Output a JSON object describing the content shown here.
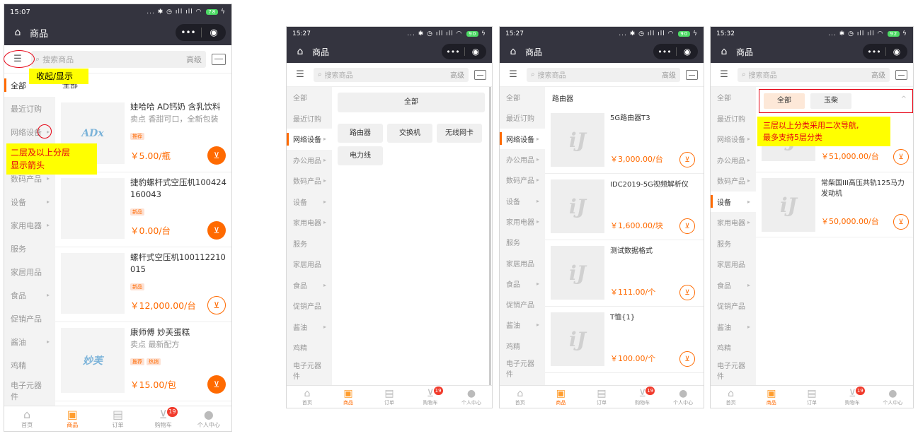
{
  "screens": [
    {
      "status_time": "15:07",
      "battery": "78",
      "nav_title": "商品",
      "search_placeholder": "搜索商品",
      "search_advanced": "高级",
      "categories": [
        "全部",
        "最近订购",
        "网络设备",
        "办公用品",
        "数码产品",
        "设备",
        "家用电器",
        "服务",
        "家居用品",
        "食品",
        "促销产品",
        "酱油",
        "鸡精",
        "电子元器件"
      ],
      "category_arrows": [
        false,
        false,
        true,
        true,
        true,
        true,
        true,
        false,
        false,
        true,
        false,
        true,
        false,
        false
      ],
      "active_category": "全部",
      "main_header": "全部",
      "products": [
        {
          "name": "娃哈哈 AD钙奶 含乳饮料",
          "sub": "卖点 香甜可口，全新包装",
          "tags": [
            "推荐"
          ],
          "price": "￥5.00/瓶",
          "cart": "filled"
        },
        {
          "name": "捷豹螺杆式空压机100424160043",
          "sub": "",
          "tags": [
            "新品"
          ],
          "price": "￥0.00/台",
          "cart": "filled"
        },
        {
          "name": "螺杆式空压机100112210015",
          "sub": "",
          "tags": [
            "新品"
          ],
          "price": "￥12,000.00/台",
          "cart": "outline"
        },
        {
          "name": "康师傅 妙芙蛋糕",
          "sub": "卖点 最新配方",
          "tags": [
            "推荐",
            "热销"
          ],
          "price": "￥15.00/包",
          "cart": "filled"
        }
      ],
      "product_thumb_labels": [
        "ADx",
        "",
        "",
        "妙芙"
      ],
      "annotations": {
        "collapse": "收起/显示",
        "arrow_note": "二层及以上分层\n显示箭头"
      }
    },
    {
      "status_time": "15:27",
      "battery": "90",
      "nav_title": "商品",
      "search_placeholder": "搜索商品",
      "search_advanced": "高级",
      "categories": [
        "全部",
        "最近订购",
        "网络设备",
        "办公用品",
        "数码产品",
        "设备",
        "家用电器",
        "服务",
        "家居用品",
        "食品",
        "促销产品",
        "酱油",
        "鸡精",
        "电子元器件"
      ],
      "category_arrows": [
        false,
        false,
        true,
        true,
        true,
        true,
        true,
        false,
        false,
        true,
        false,
        true,
        false,
        false
      ],
      "active_category": "网络设备",
      "sub_all": "全部",
      "sub_chips": [
        "路由器",
        "交换机",
        "无线网卡",
        "电力线"
      ]
    },
    {
      "status_time": "15:27",
      "battery": "90",
      "nav_title": "商品",
      "search_placeholder": "搜索商品",
      "search_advanced": "高级",
      "categories": [
        "全部",
        "最近订购",
        "网络设备",
        "办公用品",
        "数码产品",
        "设备",
        "家用电器",
        "服务",
        "家居用品",
        "食品",
        "促销产品",
        "酱油",
        "鸡精",
        "电子元器件"
      ],
      "category_arrows": [
        false,
        false,
        true,
        true,
        true,
        true,
        true,
        false,
        false,
        true,
        false,
        true,
        false,
        false
      ],
      "active_category": "网络设备",
      "main_header": "路由器",
      "products": [
        {
          "name": "5G路由器T3",
          "price": "￥3,000.00/台"
        },
        {
          "name": "IDC2019-5G视频解析仪",
          "price": "￥1,600.00/块"
        },
        {
          "name": "测试数据格式",
          "price": "￥111.00/个"
        },
        {
          "name": "T恤{1}",
          "price": "￥100.00/个"
        }
      ],
      "placeholder_logo": "iJ"
    },
    {
      "status_time": "15:32",
      "battery": "92",
      "nav_title": "商品",
      "search_placeholder": "搜索商品",
      "search_advanced": "高级",
      "categories": [
        "全部",
        "最近订购",
        "网络设备",
        "办公用品",
        "数码产品",
        "设备",
        "家用电器",
        "服务",
        "家居用品",
        "食品",
        "促销产品",
        "酱油",
        "鸡精",
        "电子元器件"
      ],
      "category_arrows": [
        false,
        false,
        true,
        true,
        true,
        true,
        true,
        false,
        false,
        true,
        false,
        true,
        false,
        false
      ],
      "active_category": "设备",
      "sub_tabs": [
        "全部",
        "玉柴"
      ],
      "products": [
        {
          "name": "",
          "price": "￥51,000.00/台"
        },
        {
          "name": "常柴国III高压共轨125马力发动机",
          "price": "￥50,000.00/台"
        }
      ],
      "placeholder_logo": "iJ",
      "annotation": "三层以上分类采用二次导航,\n最多支持5层分类"
    }
  ],
  "tabbar": [
    {
      "label": "首页",
      "icon": "home-icon"
    },
    {
      "label": "商品",
      "icon": "bag-icon"
    },
    {
      "label": "订单",
      "icon": "clipboard-icon"
    },
    {
      "label": "购物车",
      "icon": "cart-icon",
      "badge": "19"
    },
    {
      "label": "个人中心",
      "icon": "user-icon"
    }
  ],
  "colors": {
    "accent": "#ff6a00",
    "nav": "#34343f",
    "annotation_yellow": "#ffff00",
    "annotation_red": "#e60012"
  }
}
